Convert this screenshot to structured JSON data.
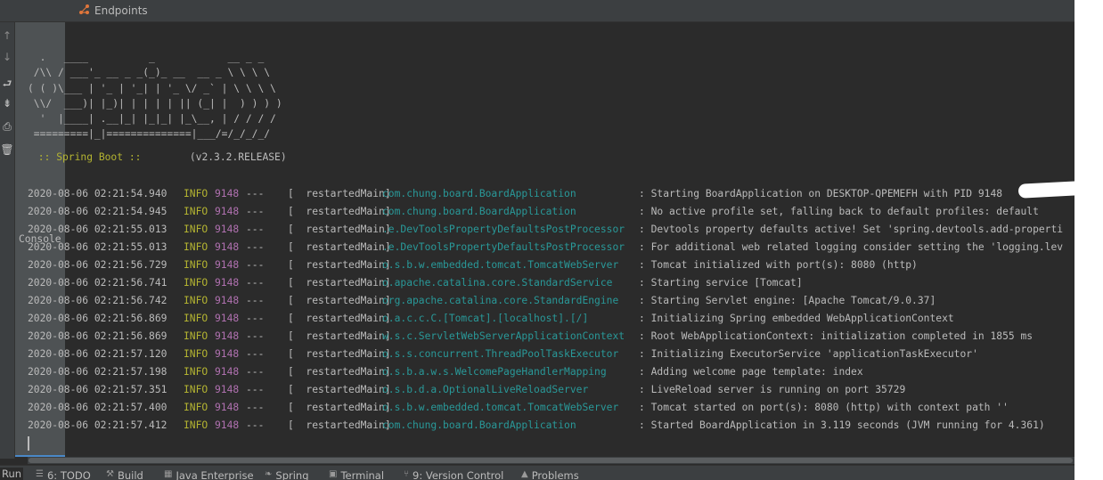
{
  "tabs": {
    "console": "Console",
    "endpoints": "Endpoints"
  },
  "banner": "  .   ____          _            __ _ _\n /\\\\ / ___'_ __ _ _(_)_ __  __ _ \\ \\ \\ \\\n( ( )\\___ | '_ | '_| | '_ \\/ _` | \\ \\ \\ \\\n \\\\/  ___)| |_)| | | | | || (_| |  ) ) ) )\n  '  |____| .__|_| |_|_| |_\\__, | / / / /\n =========|_|==============|___/=/_/_/_/",
  "spring_boot": {
    "label": " :: Spring Boot :: ",
    "version": "       (v2.3.2.RELEASE)"
  },
  "logs": [
    {
      "ts": "2020-08-06 02:21:54.940",
      "level": "INFO",
      "pid": "9148",
      "sep": "---",
      "thread": "[  restartedMain]",
      "logger": "com.chung.board.BoardApplication",
      "msg": ": Starting BoardApplication on DESKTOP-QPEMEFH with PID 9148"
    },
    {
      "ts": "2020-08-06 02:21:54.945",
      "level": "INFO",
      "pid": "9148",
      "sep": "---",
      "thread": "[  restartedMain]",
      "logger": "com.chung.board.BoardApplication",
      "msg": ": No active profile set, falling back to default profiles: default"
    },
    {
      "ts": "2020-08-06 02:21:55.013",
      "level": "INFO",
      "pid": "9148",
      "sep": "---",
      "thread": "[  restartedMain]",
      "logger": ".e.DevToolsPropertyDefaultsPostProcessor",
      "msg": ": Devtools property defaults active! Set 'spring.devtools.add-properti"
    },
    {
      "ts": "2020-08-06 02:21:55.013",
      "level": "INFO",
      "pid": "9148",
      "sep": "---",
      "thread": "[  restartedMain]",
      "logger": ".e.DevToolsPropertyDefaultsPostProcessor",
      "msg": ": For additional web related logging consider setting the 'logging.lev"
    },
    {
      "ts": "2020-08-06 02:21:56.729",
      "level": "INFO",
      "pid": "9148",
      "sep": "---",
      "thread": "[  restartedMain]",
      "logger": "o.s.b.w.embedded.tomcat.TomcatWebServer",
      "msg": ": Tomcat initialized with port(s): 8080 (http)"
    },
    {
      "ts": "2020-08-06 02:21:56.741",
      "level": "INFO",
      "pid": "9148",
      "sep": "---",
      "thread": "[  restartedMain]",
      "logger": "o.apache.catalina.core.StandardService",
      "msg": ": Starting service [Tomcat]"
    },
    {
      "ts": "2020-08-06 02:21:56.742",
      "level": "INFO",
      "pid": "9148",
      "sep": "---",
      "thread": "[  restartedMain]",
      "logger": "org.apache.catalina.core.StandardEngine",
      "msg": ": Starting Servlet engine: [Apache Tomcat/9.0.37]"
    },
    {
      "ts": "2020-08-06 02:21:56.869",
      "level": "INFO",
      "pid": "9148",
      "sep": "---",
      "thread": "[  restartedMain]",
      "logger": "o.a.c.c.C.[Tomcat].[localhost].[/]",
      "msg": ": Initializing Spring embedded WebApplicationContext"
    },
    {
      "ts": "2020-08-06 02:21:56.869",
      "level": "INFO",
      "pid": "9148",
      "sep": "---",
      "thread": "[  restartedMain]",
      "logger": "w.s.c.ServletWebServerApplicationContext",
      "msg": ": Root WebApplicationContext: initialization completed in 1855 ms"
    },
    {
      "ts": "2020-08-06 02:21:57.120",
      "level": "INFO",
      "pid": "9148",
      "sep": "---",
      "thread": "[  restartedMain]",
      "logger": "o.s.s.concurrent.ThreadPoolTaskExecutor",
      "msg": ": Initializing ExecutorService 'applicationTaskExecutor'"
    },
    {
      "ts": "2020-08-06 02:21:57.198",
      "level": "INFO",
      "pid": "9148",
      "sep": "---",
      "thread": "[  restartedMain]",
      "logger": "o.s.b.a.w.s.WelcomePageHandlerMapping",
      "msg": ": Adding welcome page template: index"
    },
    {
      "ts": "2020-08-06 02:21:57.351",
      "level": "INFO",
      "pid": "9148",
      "sep": "---",
      "thread": "[  restartedMain]",
      "logger": "o.s.b.d.a.OptionalLiveReloadServer",
      "msg": ": LiveReload server is running on port 35729"
    },
    {
      "ts": "2020-08-06 02:21:57.400",
      "level": "INFO",
      "pid": "9148",
      "sep": "---",
      "thread": "[  restartedMain]",
      "logger": "o.s.b.w.embedded.tomcat.TomcatWebServer",
      "msg": ": Tomcat started on port(s): 8080 (http) with context path ''"
    },
    {
      "ts": "2020-08-06 02:21:57.412",
      "level": "INFO",
      "pid": "9148",
      "sep": "---",
      "thread": "[  restartedMain]",
      "logger": "com.chung.board.BoardApplication",
      "msg": ": Started BoardApplication in 3.119 seconds (JVM running for 4.361)"
    }
  ],
  "bottom_tools": {
    "run": "Run",
    "todo": "6: TODO",
    "build": "Build",
    "java_enterprise": "Java Enterprise",
    "spring": "Spring",
    "terminal": "Terminal",
    "version_control": "9: Version Control",
    "problems": "Problems"
  },
  "colors": {
    "background": "#2b2b2b",
    "panel": "#3c3f41",
    "text": "#bbbbbb",
    "info": "#b4b431",
    "pid": "#b071b0",
    "logger": "#299999"
  }
}
